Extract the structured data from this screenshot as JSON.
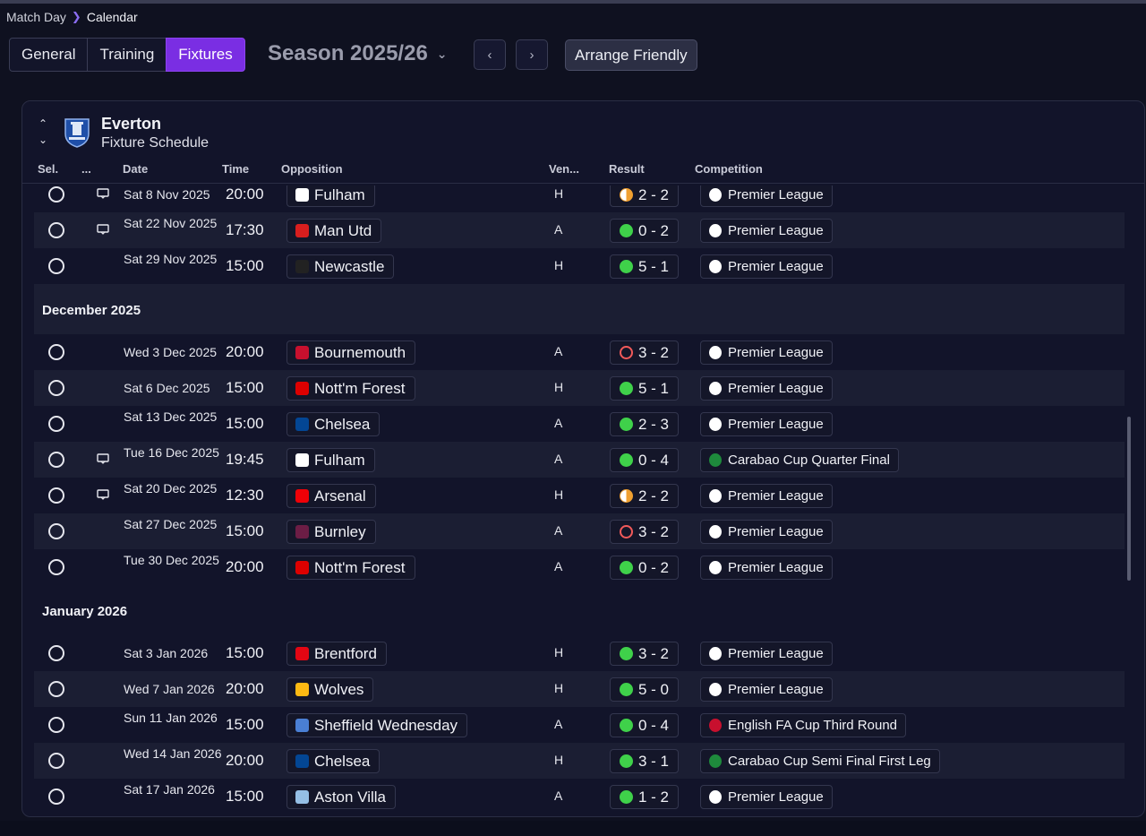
{
  "breadcrumb": {
    "parent": "Match Day",
    "current": "Calendar"
  },
  "tabs": [
    {
      "label": "General",
      "active": false
    },
    {
      "label": "Training",
      "active": false
    },
    {
      "label": "Fixtures",
      "active": true
    }
  ],
  "season": {
    "label": "Season 2025/26"
  },
  "actions": {
    "arrange_friendly": "Arrange Friendly"
  },
  "panel": {
    "team": "Everton",
    "subtitle": "Fixture Schedule"
  },
  "columns": {
    "sel": "Sel.",
    "more": "...",
    "date": "Date",
    "time": "Time",
    "opposition": "Opposition",
    "venue": "Ven...",
    "result": "Result",
    "competition": "Competition"
  },
  "colors": {
    "accent": "#7a2ee3",
    "win": "#3fd14a",
    "loss": "#f25a5a",
    "draw": "#f0a030"
  },
  "months": [
    {
      "label": "December 2025"
    },
    {
      "label": "January 2026"
    }
  ],
  "fixtures": [
    {
      "date": "Sat 8 Nov 2025",
      "time": "20:00",
      "opponent": "Fulham",
      "badge": "#ffffff",
      "venue": "H",
      "result": "2 - 2",
      "outcome": "draw",
      "competition": "Premier League",
      "comp_icon": "premier-league",
      "note": true
    },
    {
      "date": "Sat 22 Nov 2025",
      "time": "17:30",
      "opponent": "Man Utd",
      "badge": "#d81e1e",
      "venue": "A",
      "result": "0 - 2",
      "outcome": "win",
      "competition": "Premier League",
      "comp_icon": "premier-league",
      "note": true
    },
    {
      "date": "Sat 29 Nov 2025",
      "time": "15:00",
      "opponent": "Newcastle",
      "badge": "#222222",
      "venue": "H",
      "result": "5 - 1",
      "outcome": "win",
      "competition": "Premier League",
      "comp_icon": "premier-league",
      "note": false
    },
    {
      "date": "Wed 3 Dec 2025",
      "time": "20:00",
      "opponent": "Bournemouth",
      "badge": "#c8102e",
      "venue": "A",
      "result": "3 - 2",
      "outcome": "loss",
      "competition": "Premier League",
      "comp_icon": "premier-league",
      "note": false
    },
    {
      "date": "Sat 6 Dec 2025",
      "time": "15:00",
      "opponent": "Nott'm Forest",
      "badge": "#dd0000",
      "venue": "H",
      "result": "5 - 1",
      "outcome": "win",
      "competition": "Premier League",
      "comp_icon": "premier-league",
      "note": false
    },
    {
      "date": "Sat 13 Dec 2025",
      "time": "15:00",
      "opponent": "Chelsea",
      "badge": "#034694",
      "venue": "A",
      "result": "2 - 3",
      "outcome": "win",
      "competition": "Premier League",
      "comp_icon": "premier-league",
      "note": false
    },
    {
      "date": "Tue 16 Dec 2025",
      "time": "19:45",
      "opponent": "Fulham",
      "badge": "#ffffff",
      "venue": "A",
      "result": "0 - 4",
      "outcome": "win",
      "competition": "Carabao Cup Quarter Final",
      "comp_icon": "carabao-cup",
      "note": true
    },
    {
      "date": "Sat 20 Dec 2025",
      "time": "12:30",
      "opponent": "Arsenal",
      "badge": "#ef0107",
      "venue": "H",
      "result": "2 - 2",
      "outcome": "draw",
      "competition": "Premier League",
      "comp_icon": "premier-league",
      "note": true
    },
    {
      "date": "Sat 27 Dec 2025",
      "time": "15:00",
      "opponent": "Burnley",
      "badge": "#6c1d45",
      "venue": "A",
      "result": "3 - 2",
      "outcome": "loss",
      "competition": "Premier League",
      "comp_icon": "premier-league",
      "note": false
    },
    {
      "date": "Tue 30 Dec 2025",
      "time": "20:00",
      "opponent": "Nott'm Forest",
      "badge": "#dd0000",
      "venue": "A",
      "result": "0 - 2",
      "outcome": "win",
      "competition": "Premier League",
      "comp_icon": "premier-league",
      "note": false
    },
    {
      "date": "Sat 3 Jan 2026",
      "time": "15:00",
      "opponent": "Brentford",
      "badge": "#e30613",
      "venue": "H",
      "result": "3 - 2",
      "outcome": "win",
      "competition": "Premier League",
      "comp_icon": "premier-league",
      "note": false
    },
    {
      "date": "Wed 7 Jan 2026",
      "time": "20:00",
      "opponent": "Wolves",
      "badge": "#fdb913",
      "venue": "H",
      "result": "5 - 0",
      "outcome": "win",
      "competition": "Premier League",
      "comp_icon": "premier-league",
      "note": false
    },
    {
      "date": "Sun 11 Jan 2026",
      "time": "15:00",
      "opponent": "Sheffield Wednesday",
      "badge": "#4a7fd4",
      "venue": "A",
      "result": "0 - 4",
      "outcome": "win",
      "competition": "English FA Cup Third Round",
      "comp_icon": "fa-cup",
      "note": false
    },
    {
      "date": "Wed 14 Jan 2026",
      "time": "20:00",
      "opponent": "Chelsea",
      "badge": "#034694",
      "venue": "H",
      "result": "3 - 1",
      "outcome": "win",
      "competition": "Carabao Cup Semi Final First Leg",
      "comp_icon": "carabao-cup",
      "note": false
    },
    {
      "date": "Sat 17 Jan 2026",
      "time": "15:00",
      "opponent": "Aston Villa",
      "badge": "#95bfe5",
      "venue": "A",
      "result": "1 - 2",
      "outcome": "win",
      "competition": "Premier League",
      "comp_icon": "premier-league",
      "note": false
    }
  ]
}
